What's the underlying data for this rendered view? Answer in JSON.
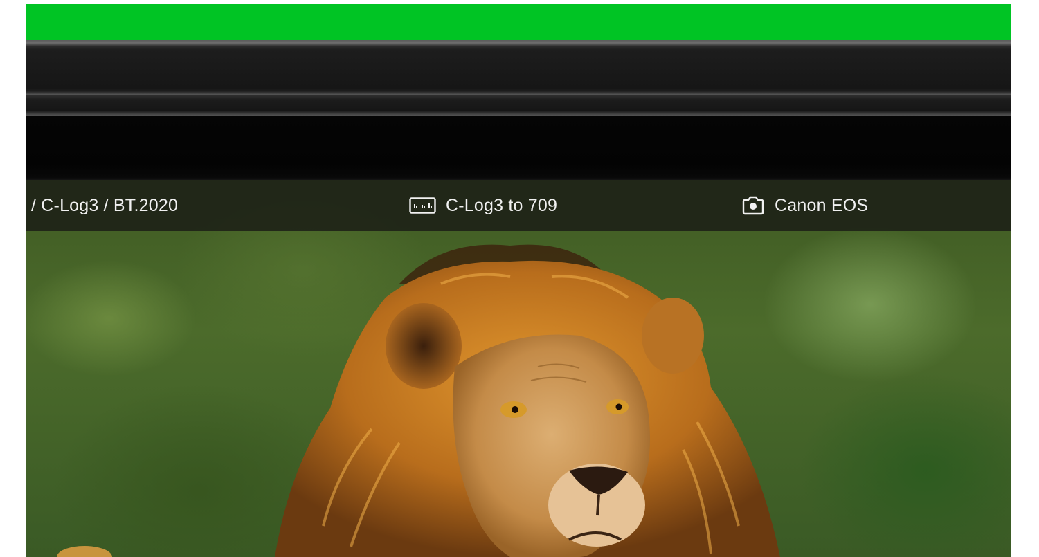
{
  "colors": {
    "accent_bar": "#00c424",
    "info_bar_text": "#f1f1f1"
  },
  "info_bar": {
    "color_space": "/ C-Log3 / BT.2020",
    "lut": {
      "icon": "lut-icon",
      "label": "C-Log3 to 709"
    },
    "camera": {
      "icon": "camera-icon",
      "label": "Canon EOS"
    }
  },
  "preview": {
    "subject": "lion"
  }
}
